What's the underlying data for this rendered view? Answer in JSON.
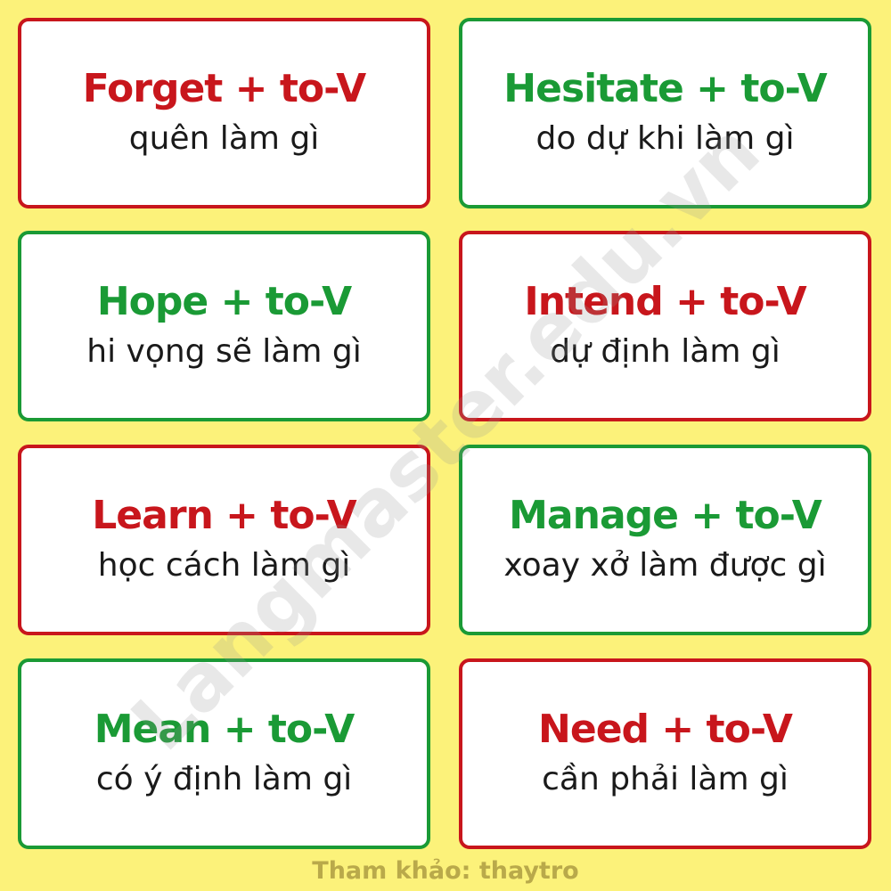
{
  "colors": {
    "background": "#fcf27a",
    "red": "#c8161c",
    "green": "#1a9a35",
    "footer": "#b9a94a"
  },
  "cards": [
    {
      "term": "Forget + to-V",
      "meaning": "quên làm gì",
      "color": "red"
    },
    {
      "term": "Hesitate + to-V",
      "meaning": "do dự khi làm gì",
      "color": "green"
    },
    {
      "term": "Hope + to-V",
      "meaning": "hi vọng sẽ làm gì",
      "color": "green"
    },
    {
      "term": "Intend + to-V",
      "meaning": "dự định làm gì",
      "color": "red"
    },
    {
      "term": "Learn + to-V",
      "meaning": "học cách làm gì",
      "color": "red"
    },
    {
      "term": "Manage + to-V",
      "meaning": "xoay xở làm được gì",
      "color": "green"
    },
    {
      "term": "Mean + to-V",
      "meaning": "có ý định làm gì",
      "color": "green"
    },
    {
      "term": "Need + to-V",
      "meaning": "cần phải làm gì",
      "color": "red"
    }
  ],
  "watermark": "Langmaster.edu.vn",
  "footer": "Tham khảo: thaytro"
}
